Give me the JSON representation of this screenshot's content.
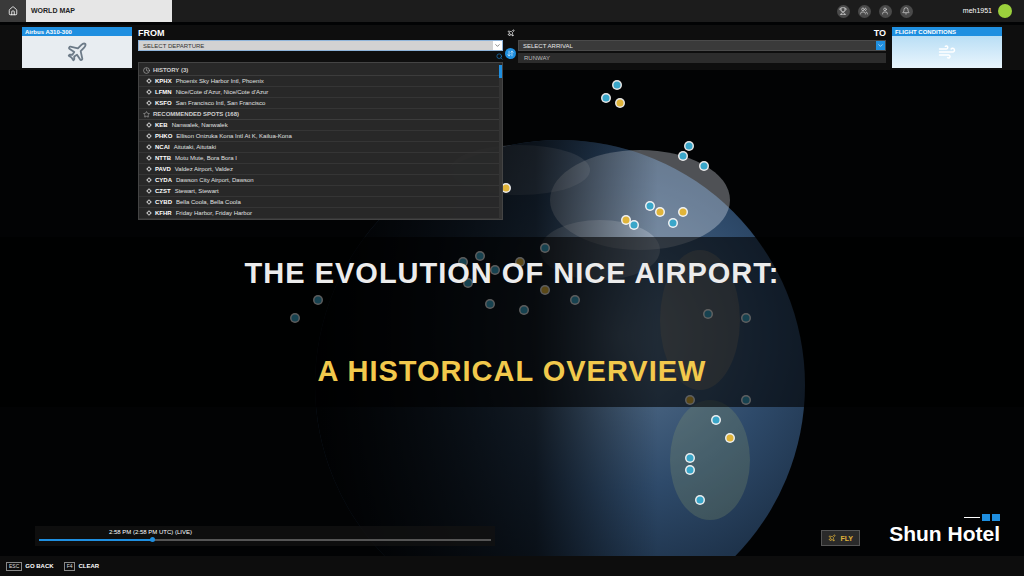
{
  "top_bar": {
    "title": "WORLD MAP",
    "user": "meh1951"
  },
  "aircraft": {
    "name": "Airbus A310-300"
  },
  "departure": {
    "label": "FROM",
    "placeholder": "SELECT DEPARTURE"
  },
  "arrival": {
    "label": "TO",
    "placeholder": "SELECT ARRIVAL",
    "runway": "RUNWAY"
  },
  "flight_conditions": {
    "label": "FLIGHT CONDITIONS"
  },
  "dropdown": {
    "sections": [
      {
        "kind": "history",
        "title": "HISTORY (3)",
        "items": [
          {
            "code": "KPHX",
            "name": "Phoenix Sky Harbor Intl, Phoenix"
          },
          {
            "code": "LFMN",
            "name": "Nice/Cote d'Azur, Nice/Cote d'Azur"
          },
          {
            "code": "KSFO",
            "name": "San Francisco Intl, San Francisco"
          }
        ]
      },
      {
        "kind": "recommended",
        "title": "RECOMMENDED SPOTS (168)",
        "items": [
          {
            "code": "KEB",
            "name": "Nanwalek, Nanwalek"
          },
          {
            "code": "PHKO",
            "name": "Ellison Onizuka Kona Intl At K, Kailua-Kona"
          },
          {
            "code": "NCAI",
            "name": "Aitutaki, Aitutaki"
          },
          {
            "code": "NTTB",
            "name": "Motu Mute, Bora Bora I"
          },
          {
            "code": "PAVD",
            "name": "Valdez Airport, Valdez"
          },
          {
            "code": "CYDA",
            "name": "Dawson City Airport, Dawson"
          },
          {
            "code": "CZST",
            "name": "Stewart, Stewart"
          },
          {
            "code": "CYBD",
            "name": "Bella Coola, Bella Coola"
          },
          {
            "code": "KFHR",
            "name": "Friday Harbor, Friday Harbor"
          }
        ]
      }
    ]
  },
  "banner": {
    "line1": "THE EVOLUTION OF NICE AIRPORT:",
    "line2": "A HISTORICAL OVERVIEW"
  },
  "time_slider": {
    "time": "2:58 PM (2:58 PM UTC) (LIVE)",
    "level": 0.25
  },
  "fly_button": {
    "label": "FLY"
  },
  "footer": [
    {
      "key": "ESC",
      "label": "GO BACK"
    },
    {
      "key": "F4",
      "label": "CLEAR"
    }
  ],
  "watermark": {
    "text": "Shun Hotel"
  }
}
